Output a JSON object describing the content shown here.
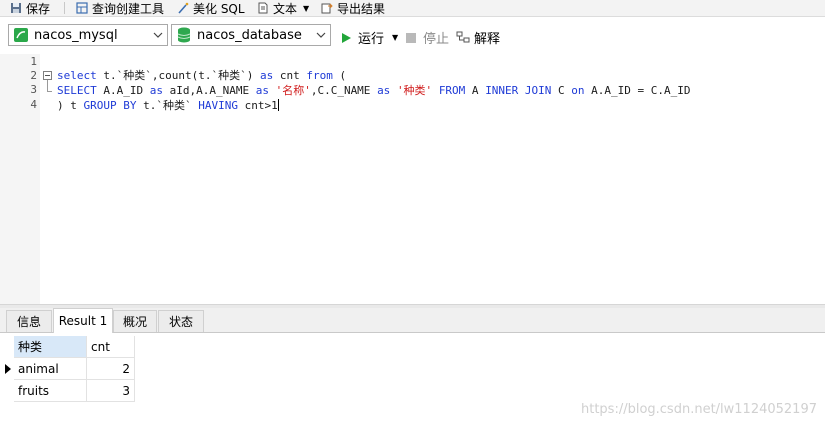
{
  "toolbar": {
    "save": "保存",
    "query_builder": "查询创建工具",
    "beautify_sql": "美化 SQL",
    "text": "文本",
    "export": "导出结果"
  },
  "selectors": {
    "connection": "nacos_mysql",
    "database": "nacos_database",
    "run": "运行",
    "stop": "停止",
    "explain": "解释"
  },
  "editor": {
    "line_numbers": [
      "1",
      "2",
      "3",
      "4"
    ]
  },
  "tabs": [
    "信息",
    "Result 1",
    "概况",
    "状态"
  ],
  "result": {
    "columns": [
      "种类",
      "cnt"
    ],
    "rows": [
      [
        "animal",
        "2"
      ],
      [
        "fruits",
        "3"
      ]
    ]
  },
  "watermark": "https://blog.csdn.net/lw1124052197",
  "colors": {
    "keyword": "#1f3bd6",
    "string": "#d01b1b",
    "run_green": "#22a63a",
    "selected_header": "#d8e8f8"
  }
}
